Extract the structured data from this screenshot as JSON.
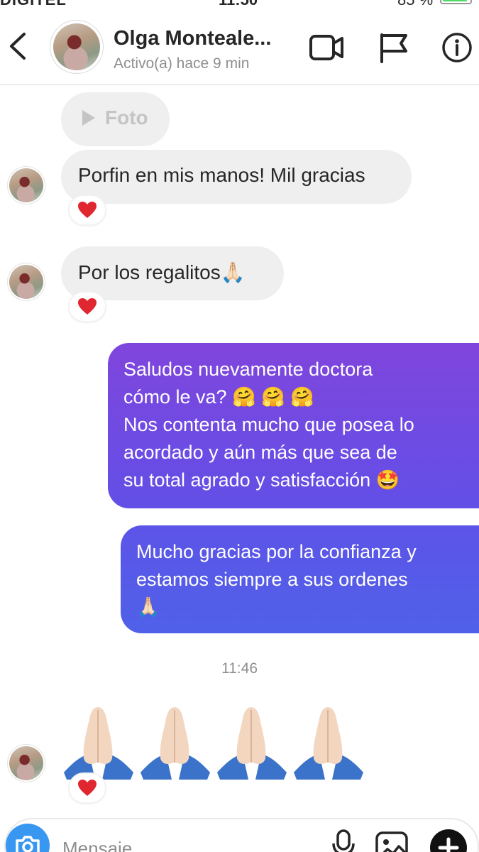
{
  "status_bar": {
    "carrier": "DIGITEL",
    "time": "11:50",
    "battery": "85 %"
  },
  "header": {
    "contact_name": "Olga Monteale...",
    "activity": "Activo(a) hace 9 min",
    "icons": [
      "back-chevron-icon",
      "avatar",
      "video-camera-icon",
      "flag-icon",
      "info-icon"
    ]
  },
  "messages": {
    "media_label": "Foto",
    "in_1": "Porfin en mis manos! Mil gracias",
    "in_2": "Por los regalitos🙏🏻",
    "out_1": {
      "line1": "Saludos nuevamente doctora",
      "line2": "cómo le va? 🤗 🤗 🤗",
      "line3": "Nos contenta mucho que posea lo",
      "line4": "acordado y aún más que sea de",
      "line5": "su total agrado y satisfacción 🤩"
    },
    "out_2": {
      "line1": "Mucho gracias por la confianza y",
      "line2": "estamos siempre a sus ordenes",
      "line3": "🙏🏻"
    },
    "timestamp": "11:46",
    "reaction": "❤️"
  },
  "composer": {
    "placeholder": "Mensaje"
  },
  "colors": {
    "outgoing_top": "#8045dc",
    "outgoing_bottom": "#4f61e8",
    "incoming_bg": "#efefef",
    "camera_button": "#3897f0",
    "reaction_heart": "#e0262f"
  }
}
